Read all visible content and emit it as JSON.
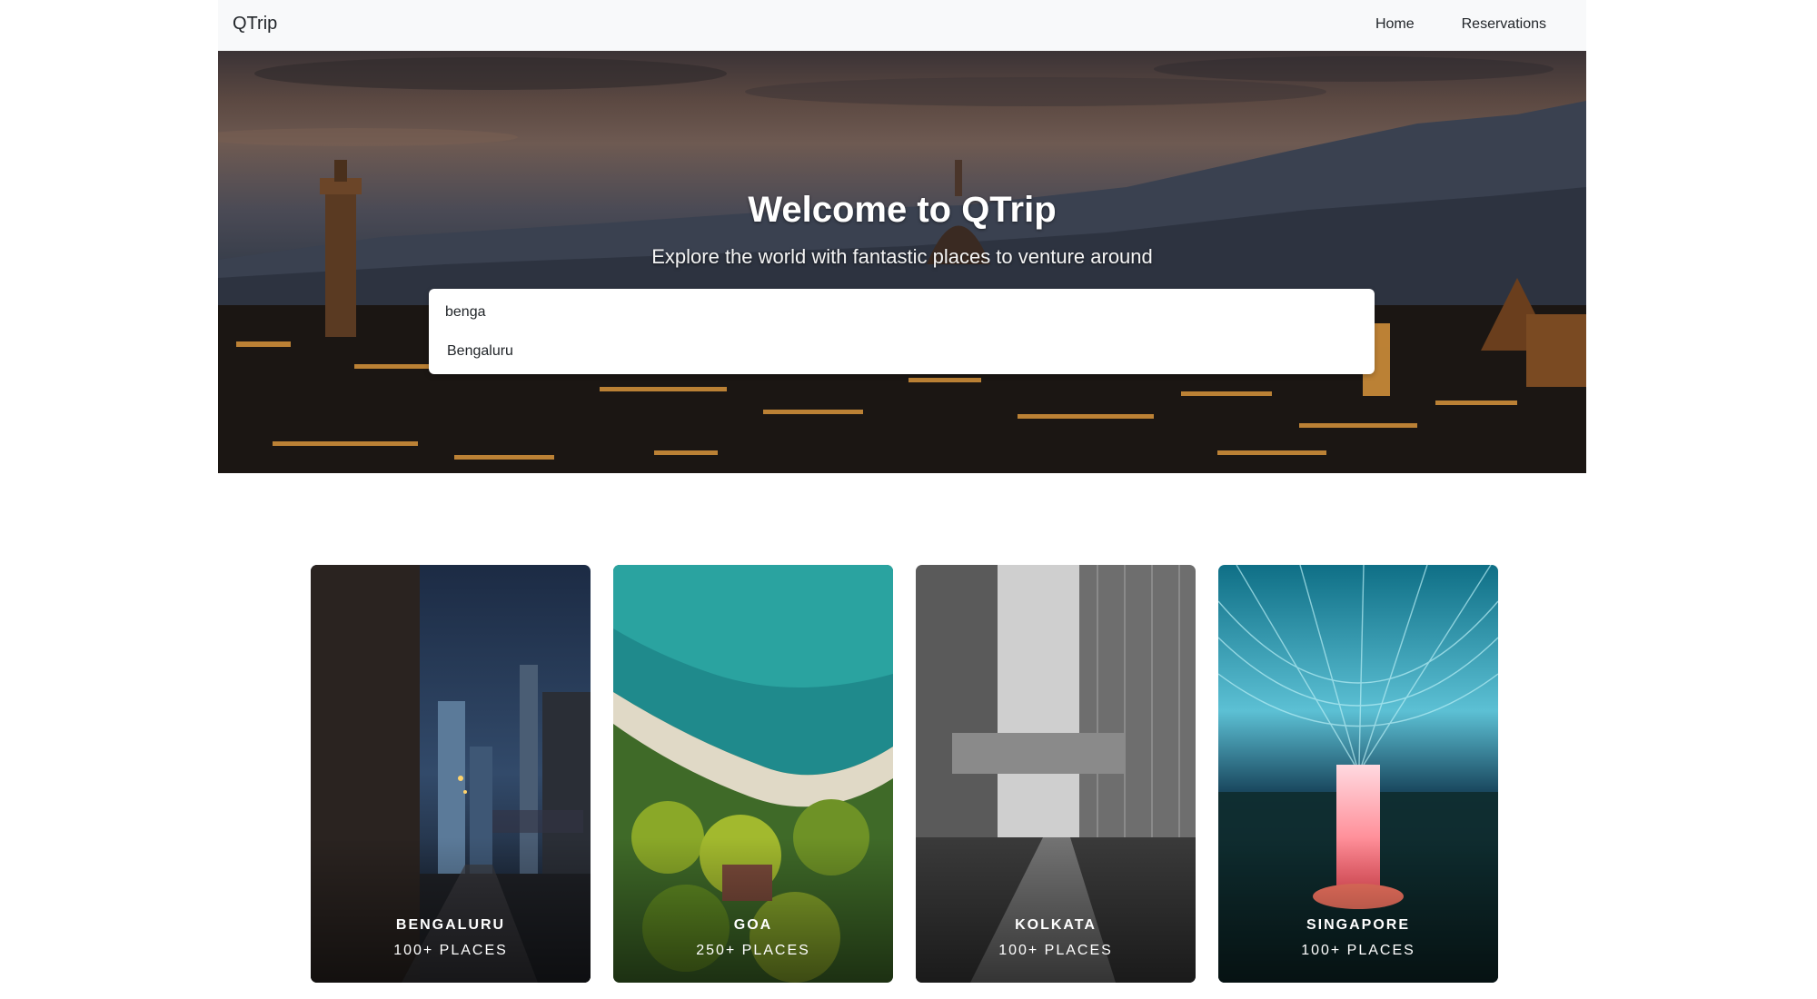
{
  "navbar": {
    "brand": "QTrip",
    "links": [
      {
        "label": "Home"
      },
      {
        "label": "Reservations"
      }
    ]
  },
  "hero": {
    "title": "Welcome to QTrip",
    "subtitle": "Explore the world with fantastic places to venture around"
  },
  "search": {
    "value": "benga",
    "suggestions": [
      "Bengaluru"
    ]
  },
  "cities": [
    {
      "name": "BENGALURU",
      "places": "100+ PLACES"
    },
    {
      "name": "GOA",
      "places": "250+ PLACES"
    },
    {
      "name": "KOLKATA",
      "places": "100+ PLACES"
    },
    {
      "name": "SINGAPORE",
      "places": "100+ PLACES"
    }
  ],
  "colors": {
    "navbar_bg": "#f8f9fa",
    "text_dark": "#212529",
    "card_text": "#ffffff"
  }
}
